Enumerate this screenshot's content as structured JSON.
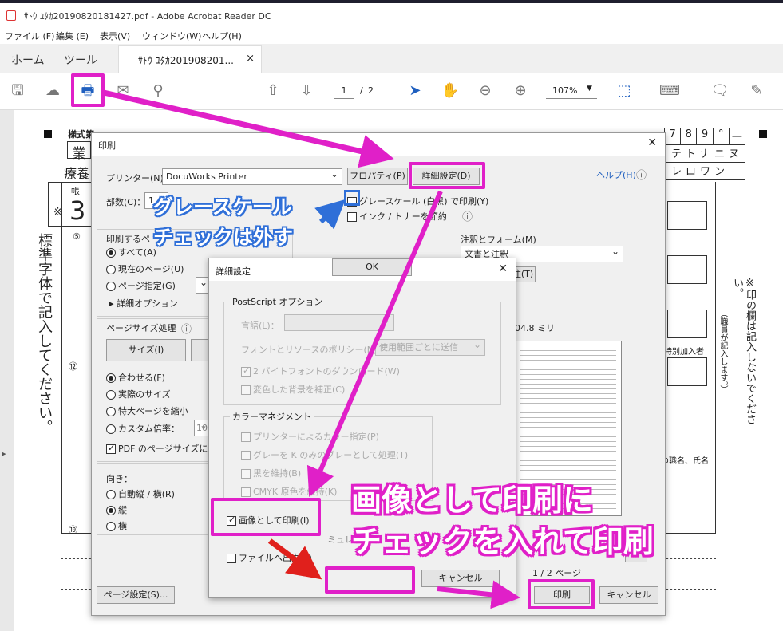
{
  "window": {
    "title": "ｻﾄｳ ﾕﾀｶ20190820181427.pdf - Adobe Acrobat Reader DC"
  },
  "menu": [
    "ファイル (F)",
    "編集 (E)",
    "表示(V)",
    "ウィンドウ(W)",
    "ヘルプ(H)"
  ],
  "tabs": {
    "home": "ホーム",
    "tools": "ツール",
    "doc": "ｻﾄｳ ﾕﾀｶ201908201...",
    "close": "×"
  },
  "toolbar": {
    "page_current": "1",
    "page_sep": "/",
    "page_total": "2",
    "zoom": "107%"
  },
  "print_dialog": {
    "title": "印刷",
    "printer_label": "プリンター(N)：",
    "printer_value": "DocuWorks Printer",
    "properties_btn": "プロパティ(P)",
    "advanced_btn": "詳細設定(D)",
    "help_link": "ヘルプ(H)",
    "copies_label": "部数(C)：",
    "copies_value": "1",
    "grayscale_label": "グレースケール (白黒) で印刷(Y)",
    "save_ink_label": "インク / トナーを節約",
    "pages_group": "印刷するペ",
    "all": "すべて(A)",
    "current_page": "現在のページ(U)",
    "page_range": "ページ指定(G)",
    "more_options": "詳細オプション",
    "size_group": "ページサイズ処理",
    "size_btn": "サイズ(I)",
    "fit": "合わせる(F)",
    "actual": "実際のサイズ",
    "shrink": "特大ページを縮小",
    "custom_scale": "カスタム倍率：",
    "custom_value": "100",
    "pdf_size": "PDF のページサイズに合",
    "orient_label": "向き：",
    "auto": "自動縦 / 横(R)",
    "portrait": "縦",
    "landscape": "横",
    "annot_label": "注釈とフォーム(M)",
    "annot_value": "文書と注釈",
    "summary_btn": "注(T)",
    "paper_size": "04.8 ミリ",
    "page_count": "1 / 2 ページ",
    "page_setup_btn": "ページ設定(S)...",
    "print_btn": "印刷",
    "cancel_btn": "キャンセル",
    "next_btn": ">"
  },
  "adv_dialog": {
    "title": "詳細設定",
    "ps_group": "PostScript オプション",
    "language": "言語(L)：",
    "font_policy": "フォントとリソースのポリシー(N)：",
    "font_policy_value": "使用範囲ごとに送信",
    "twobyte": "2 バイトフォントのダウンロード(W)",
    "bg": "変色した背景を補正(C)",
    "color_group": "カラーマネジメント",
    "printer_color": "プリンターによるカラー指定(P)",
    "gray_k": "グレーを K のみのグレーとして処理(T)",
    "keep_black": "黒を維持(B)",
    "cmyk": "CMYK 原色を維持(K)",
    "as_image": "画像として印刷(I)",
    "simulate": "ミュレート",
    "to_file": "ファイルへ出力(F)",
    "ok": "OK",
    "cancel": "キャンセル"
  },
  "callouts": {
    "gray_line1": "グレースケール",
    "gray_line2": "チェックは外す",
    "image_line1": "画像として印刷に",
    "image_line2": "チェックを入れて印刷"
  },
  "doc_text": {
    "form_title": "様式第",
    "notice_right": "※印の欄は記入しないでください。",
    "notice_right2": "（職員が記入します。）",
    "left_vertical": "標準字体で記入してください。",
    "kana_row1": [
      "7",
      "8",
      "9",
      "°",
      "一"
    ],
    "kana_row2": "テトナニヌ",
    "kana_row3": "レロワン",
    "tokubetsu": "特別加入者",
    "shokumei": "の職名、氏名",
    "gyo": "業",
    "ryoyo": "療養",
    "cho": "帳",
    "big3": "3",
    "kome": "※",
    "circled5": "⑤",
    "circled12": "⑫",
    "circled19": "⑲"
  },
  "colors": {
    "accent": "#e020c8",
    "callout_blue": "#2f6fd8"
  }
}
